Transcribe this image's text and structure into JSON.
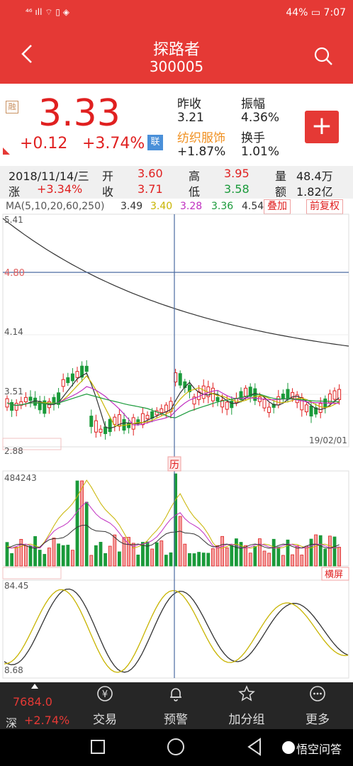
{
  "status": {
    "left": "⁴⁶ ıll ⌔ ▯ ◈",
    "right": "44% ▭ 7:07"
  },
  "header": {
    "back_icon": "chevron-left-icon",
    "title": "探路者",
    "code": "300005"
  },
  "quote": {
    "rong": "融",
    "price": "3.33",
    "change": "+0.12",
    "change_pct": "+3.74%",
    "lian": "联",
    "prev_close_label": "昨收",
    "prev_close": "3.21",
    "amplitude_label": "振幅",
    "amplitude": "4.36%",
    "sector": "纺织服饰",
    "sector_pct": "+1.87%",
    "turnover_label": "换手",
    "turnover": "1.01%",
    "add_button": "+"
  },
  "info": {
    "date": "2018/11/14/三",
    "open_label": "开",
    "open": "3.60",
    "high_label": "高",
    "high": "3.95",
    "volume_label": "量",
    "volume": "48.4万",
    "rise_label": "涨",
    "rise": "+3.34%",
    "close_label": "收",
    "close": "3.71",
    "low_label": "低",
    "low": "3.58",
    "amount_label": "额",
    "amount": "1.82亿"
  },
  "ma_bar": {
    "label": "MA(5,10,20,60,250)",
    "values": [
      "3.49",
      "3.40",
      "3.28",
      "3.36",
      "4.54"
    ],
    "colors": [
      "#333333",
      "#c8b400",
      "#c030c0",
      "#1a9a3a",
      "#333333"
    ],
    "overlay_button": "叠加",
    "adjust_button": "前复权"
  },
  "chart": {
    "price_labels": [
      "5.41",
      "4.80",
      "4.14",
      "3.51",
      "2.88"
    ],
    "date_label": "19/02/01",
    "history_marker": "历",
    "volume_max": "484243",
    "landscape_button": "横屏",
    "kdj_top": "84.45",
    "kdj_bottom": "8.68",
    "colors": {
      "up": "#e02020",
      "down": "#1a9a3a",
      "crosshair": "#4a6aa0"
    }
  },
  "bottom_nav": {
    "index_value": "7684.0",
    "index_name": "深",
    "index_change": "+2.74%",
    "items": [
      {
        "icon": "yen-icon",
        "label": "交易"
      },
      {
        "icon": "bell-icon",
        "label": "预警"
      },
      {
        "icon": "star-icon",
        "label": "加分组"
      },
      {
        "icon": "more-icon",
        "label": "更多"
      }
    ]
  },
  "system_nav": {
    "watermark": "悟空问答"
  }
}
